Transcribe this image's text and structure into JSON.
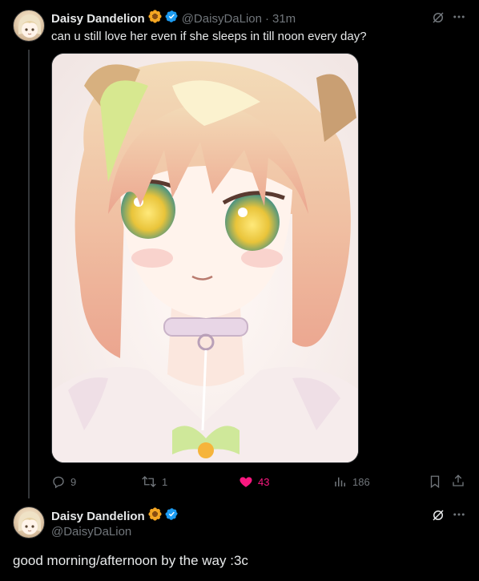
{
  "tweet1": {
    "author_name": "Daisy Dandelion",
    "handle": "@DaisyDaLion",
    "separator": "·",
    "time": "31m",
    "text": "can u still love her even if she sleeps in till noon every day?",
    "media_description_icon": "anime-portrait-image",
    "stats": {
      "replies": "9",
      "reposts": "1",
      "likes": "43",
      "views": "186"
    }
  },
  "tweet2": {
    "author_name": "Daisy Dandelion",
    "handle": "@DaisyDaLion",
    "text": "good morning/afternoon by the way :3c"
  },
  "icons": {
    "flower_badge": "flower-emoji-icon",
    "verified": "verified-badge-icon",
    "grok": "grok-icon",
    "more": "more-icon",
    "reply": "reply-icon",
    "repost": "repost-icon",
    "like": "heart-icon",
    "views": "views-icon",
    "bookmark": "bookmark-icon",
    "share": "share-icon"
  },
  "colors": {
    "background": "#000000",
    "primary_text": "#e7e9ea",
    "secondary_text": "#71767b",
    "verified": "#1d9bf0",
    "like": "#f91880",
    "divider": "#2f3336"
  }
}
